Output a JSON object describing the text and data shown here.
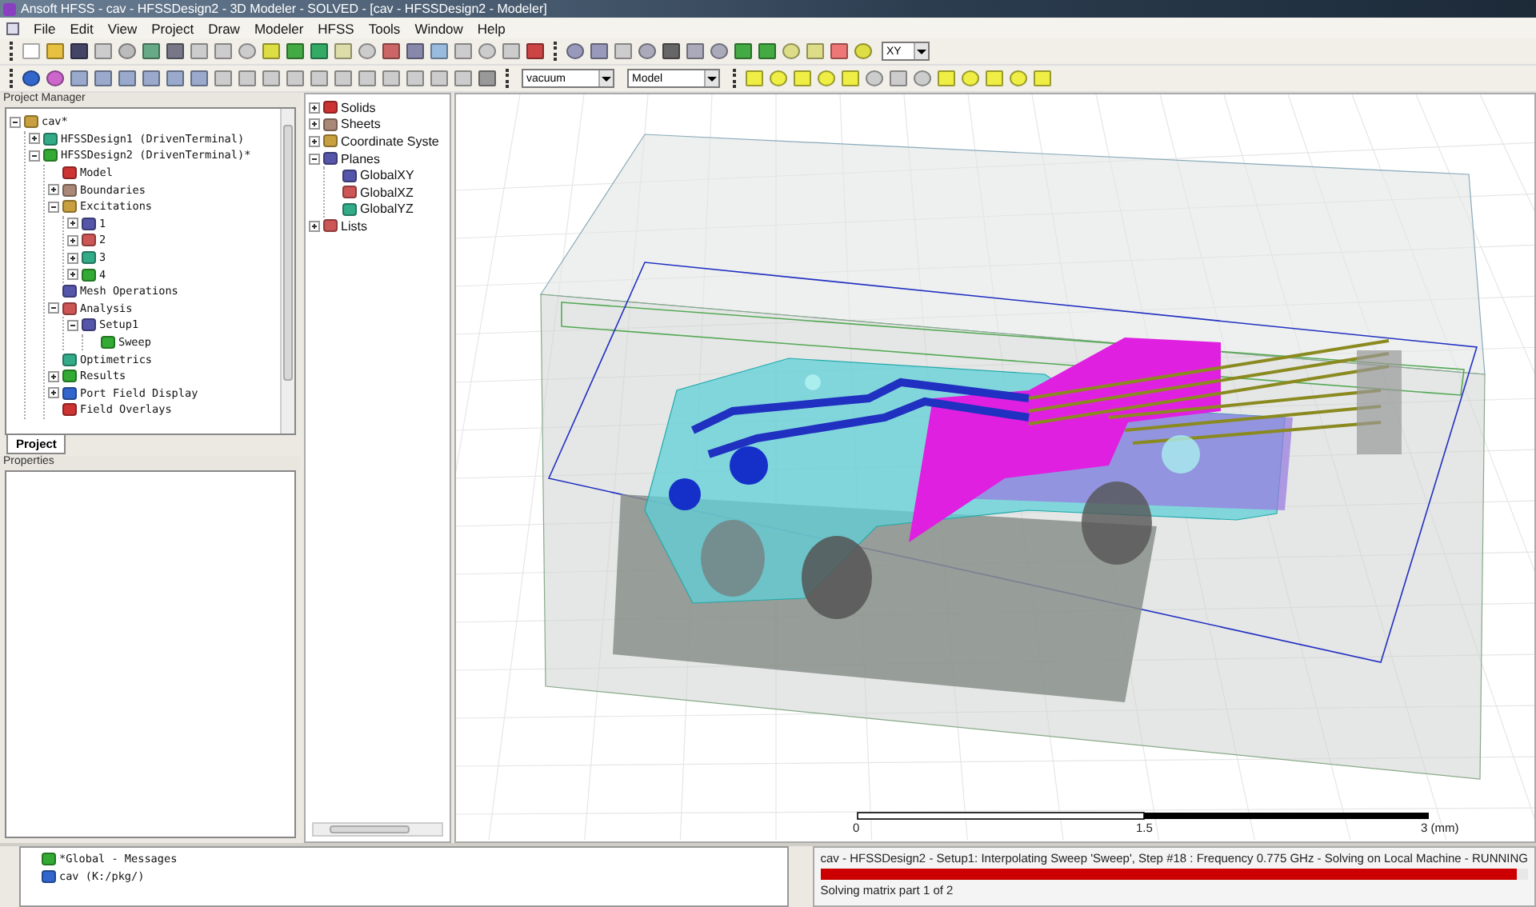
{
  "window": {
    "title": "Ansoft HFSS - cav - HFSSDesign2 - 3D Modeler - SOLVED - [cav - HFSSDesign2 - Modeler]"
  },
  "menu": [
    "File",
    "Edit",
    "View",
    "Project",
    "Draw",
    "Modeler",
    "HFSS",
    "Tools",
    "Window",
    "Help"
  ],
  "toolbar_1": {
    "dropdown": "XY"
  },
  "toolbar_2": {
    "dropdowns": [
      "vacuum",
      "Model"
    ]
  },
  "project_manager": {
    "title": "Project Manager",
    "tree": [
      {
        "label": "cav*",
        "expanded": true,
        "children": [
          {
            "label": "HFSSDesign1 (DrivenTerminal)",
            "expanded": false
          },
          {
            "label": "HFSSDesign2 (DrivenTerminal)*",
            "expanded": true,
            "children": [
              {
                "label": "Model"
              },
              {
                "label": "Boundaries",
                "expanded": false
              },
              {
                "label": "Excitations",
                "expanded": true,
                "children": [
                  {
                    "label": "1",
                    "expanded": false
                  },
                  {
                    "label": "2",
                    "expanded": false
                  },
                  {
                    "label": "3",
                    "expanded": false
                  },
                  {
                    "label": "4",
                    "expanded": false
                  }
                ]
              },
              {
                "label": "Mesh Operations"
              },
              {
                "label": "Analysis",
                "expanded": true,
                "children": [
                  {
                    "label": "Setup1",
                    "expanded": true,
                    "children": [
                      {
                        "label": "Sweep"
                      }
                    ]
                  }
                ]
              },
              {
                "label": "Optimetrics"
              },
              {
                "label": "Results",
                "expanded": false
              },
              {
                "label": "Port Field Display",
                "expanded": false
              },
              {
                "label": "Field Overlays"
              }
            ]
          }
        ]
      }
    ],
    "tabs": [
      {
        "label": "Project",
        "selected": true
      }
    ]
  },
  "properties": {
    "title": "Properties"
  },
  "model_tree": [
    {
      "label": "Solids",
      "expanded": false
    },
    {
      "label": "Sheets",
      "expanded": false
    },
    {
      "label": "Coordinate Syste",
      "expanded": false
    },
    {
      "label": "Planes",
      "expanded": true,
      "children": [
        {
          "label": "GlobalXY"
        },
        {
          "label": "GlobalXZ"
        },
        {
          "label": "GlobalYZ"
        }
      ]
    },
    {
      "label": "Lists",
      "expanded": false
    }
  ],
  "viewport": {
    "scale_labels": [
      "0",
      "1.5",
      "3 (mm)"
    ]
  },
  "messages": [
    {
      "label": "*Global - Messages"
    },
    {
      "label": "cav (K:/pkg/)"
    }
  ],
  "progress": {
    "status": "cav - HFSSDesign2 - Setup1: Interpolating Sweep 'Sweep', Step #18 : Frequency 0.775 GHz - Solving on Local Machine - RUNNING",
    "level": 0.985,
    "detail": "Solving matrix part 1 of 2"
  }
}
